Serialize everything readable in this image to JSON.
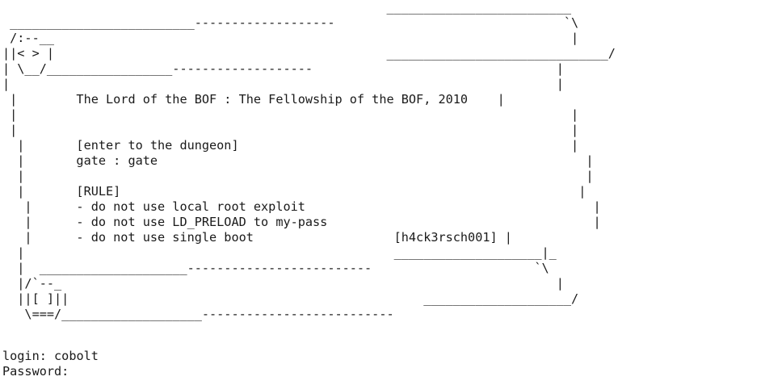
{
  "banner_lines": [
    "                                                    _________________________",
    " _________________________-------------------                               `\\",
    " /:--__                                                                      |",
    "||< > |                                             ______________________________/",
    "| \\__/_________________-------------------                                 |",
    "|                                                                          |",
    " |        The Lord of the BOF : The Fellowship of the BOF, 2010    |",
    " |                                                                           |",
    " |                                                                           |",
    "  |       [enter to the dungeon]                                             |",
    "  |       gate : gate                                                          |",
    "  |                                                                            |",
    "  |       [RULE]                                                              |",
    "   |      - do not use local root exploit                                       |",
    "   |      - do not use LD_PRELOAD to my-pass                                    |",
    "   |      - do not use single boot                   [h4ck3rsch001] |",
    "  |                                                  ____________________|_",
    "  |  ____________________-------------------------                      `\\",
    "  |/`--_                                                                   |",
    "  ||[ ]||                                                ____________________/",
    "   \\===/___________________--------------------------"
  ],
  "login": {
    "label": "login:",
    "value": "cobolt"
  },
  "password": {
    "label": "Password:",
    "value": ""
  },
  "colors": {
    "background": "#ffffff",
    "text": "#1a1a1a"
  }
}
